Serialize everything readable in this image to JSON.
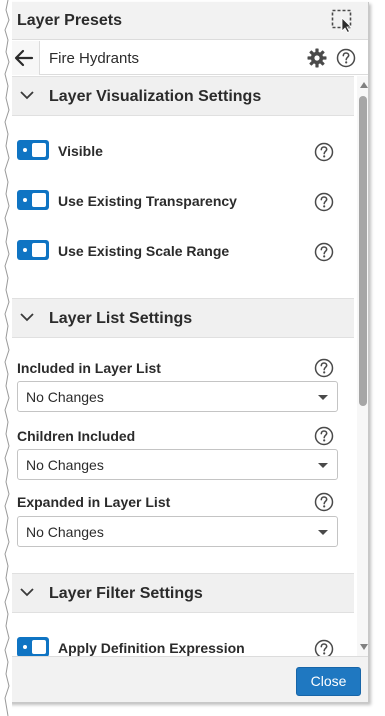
{
  "window": {
    "title": "Layer Presets",
    "select_icon": "select-cursor-icon"
  },
  "header": {
    "preset_name": "Fire Hydrants",
    "back_icon": "arrow-left-icon",
    "settings_icon": "gear-icon",
    "help_icon": "help-icon"
  },
  "sections": {
    "visualization": {
      "title": "Layer Visualization Settings",
      "toggles": [
        {
          "label": "Visible",
          "on": true
        },
        {
          "label": "Use Existing Transparency",
          "on": true
        },
        {
          "label": "Use Existing Scale Range",
          "on": true
        }
      ]
    },
    "layer_list": {
      "title": "Layer List Settings",
      "fields": [
        {
          "label": "Included in Layer List",
          "value": "No Changes"
        },
        {
          "label": "Children Included",
          "value": "No Changes"
        },
        {
          "label": "Expanded in Layer List",
          "value": "No Changes"
        }
      ]
    },
    "filter": {
      "title": "Layer Filter Settings",
      "toggles": [
        {
          "label": "Apply Definition Expression",
          "on": true
        }
      ]
    }
  },
  "footer": {
    "close_label": "Close"
  },
  "colors": {
    "accent": "#0f74c3",
    "button": "#1f78c1"
  }
}
